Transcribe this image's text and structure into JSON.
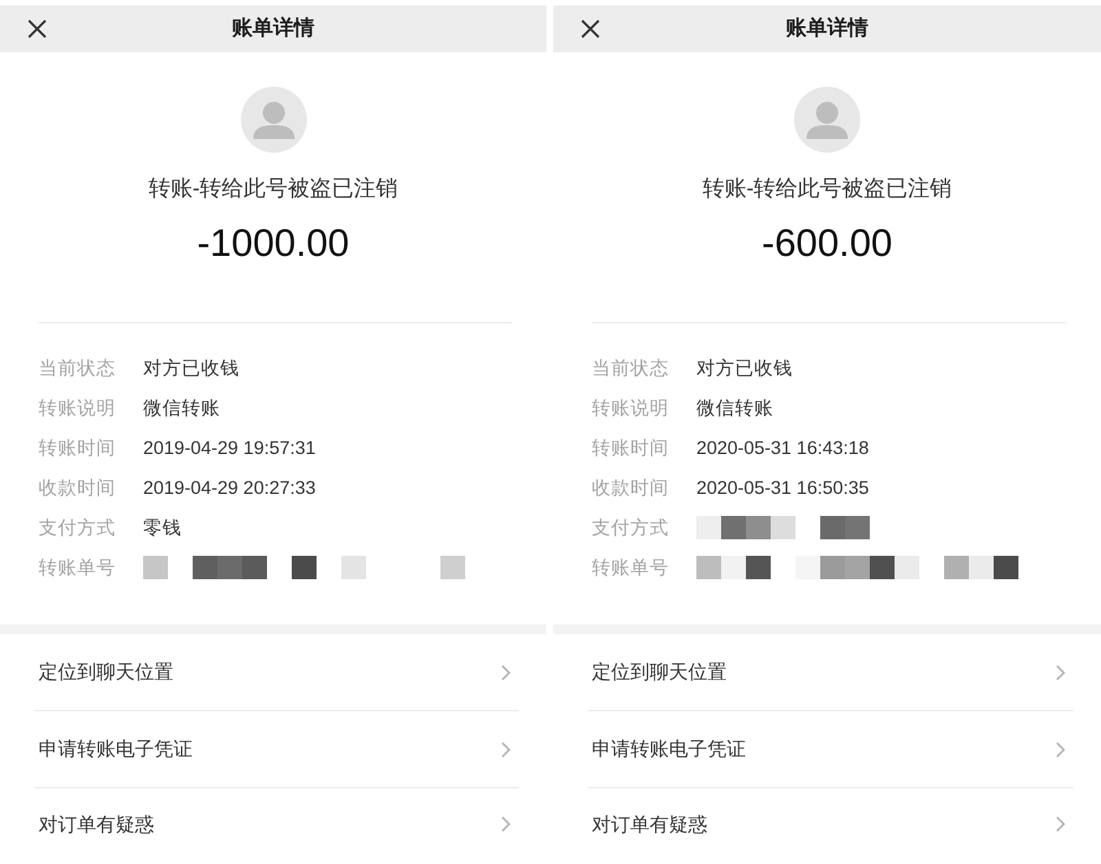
{
  "panels": [
    {
      "header": {
        "title": "账单详情"
      },
      "counterparty": "转账-转给此号被盗已注销",
      "amount": "-1000.00",
      "details": [
        {
          "label": "当前状态",
          "value": "对方已收钱",
          "redacted": false
        },
        {
          "label": "转账说明",
          "value": "微信转账",
          "redacted": false
        },
        {
          "label": "转账时间",
          "value": "2019-04-29 19:57:31",
          "redacted": false
        },
        {
          "label": "收款时间",
          "value": "2019-04-29 20:27:33",
          "redacted": false
        },
        {
          "label": "支付方式",
          "value": "零钱",
          "redacted": false
        },
        {
          "label": "转账单号",
          "redacted": true
        }
      ],
      "actions": [
        {
          "label": "定位到聊天位置"
        },
        {
          "label": "申请转账电子凭证"
        },
        {
          "label": "对订单有疑惑"
        }
      ]
    },
    {
      "header": {
        "title": "账单详情"
      },
      "counterparty": "转账-转给此号被盗已注销",
      "amount": "-600.00",
      "details": [
        {
          "label": "当前状态",
          "value": "对方已收钱",
          "redacted": false
        },
        {
          "label": "转账说明",
          "value": "微信转账",
          "redacted": false
        },
        {
          "label": "转账时间",
          "value": "2020-05-31 16:43:18",
          "redacted": false
        },
        {
          "label": "收款时间",
          "value": "2020-05-31 16:50:35",
          "redacted": false
        },
        {
          "label": "支付方式",
          "redacted": true
        },
        {
          "label": "转账单号",
          "redacted": true
        }
      ],
      "actions": [
        {
          "label": "定位到聊天位置"
        },
        {
          "label": "申请转账电子凭证"
        },
        {
          "label": "对订单有疑惑"
        }
      ]
    }
  ]
}
